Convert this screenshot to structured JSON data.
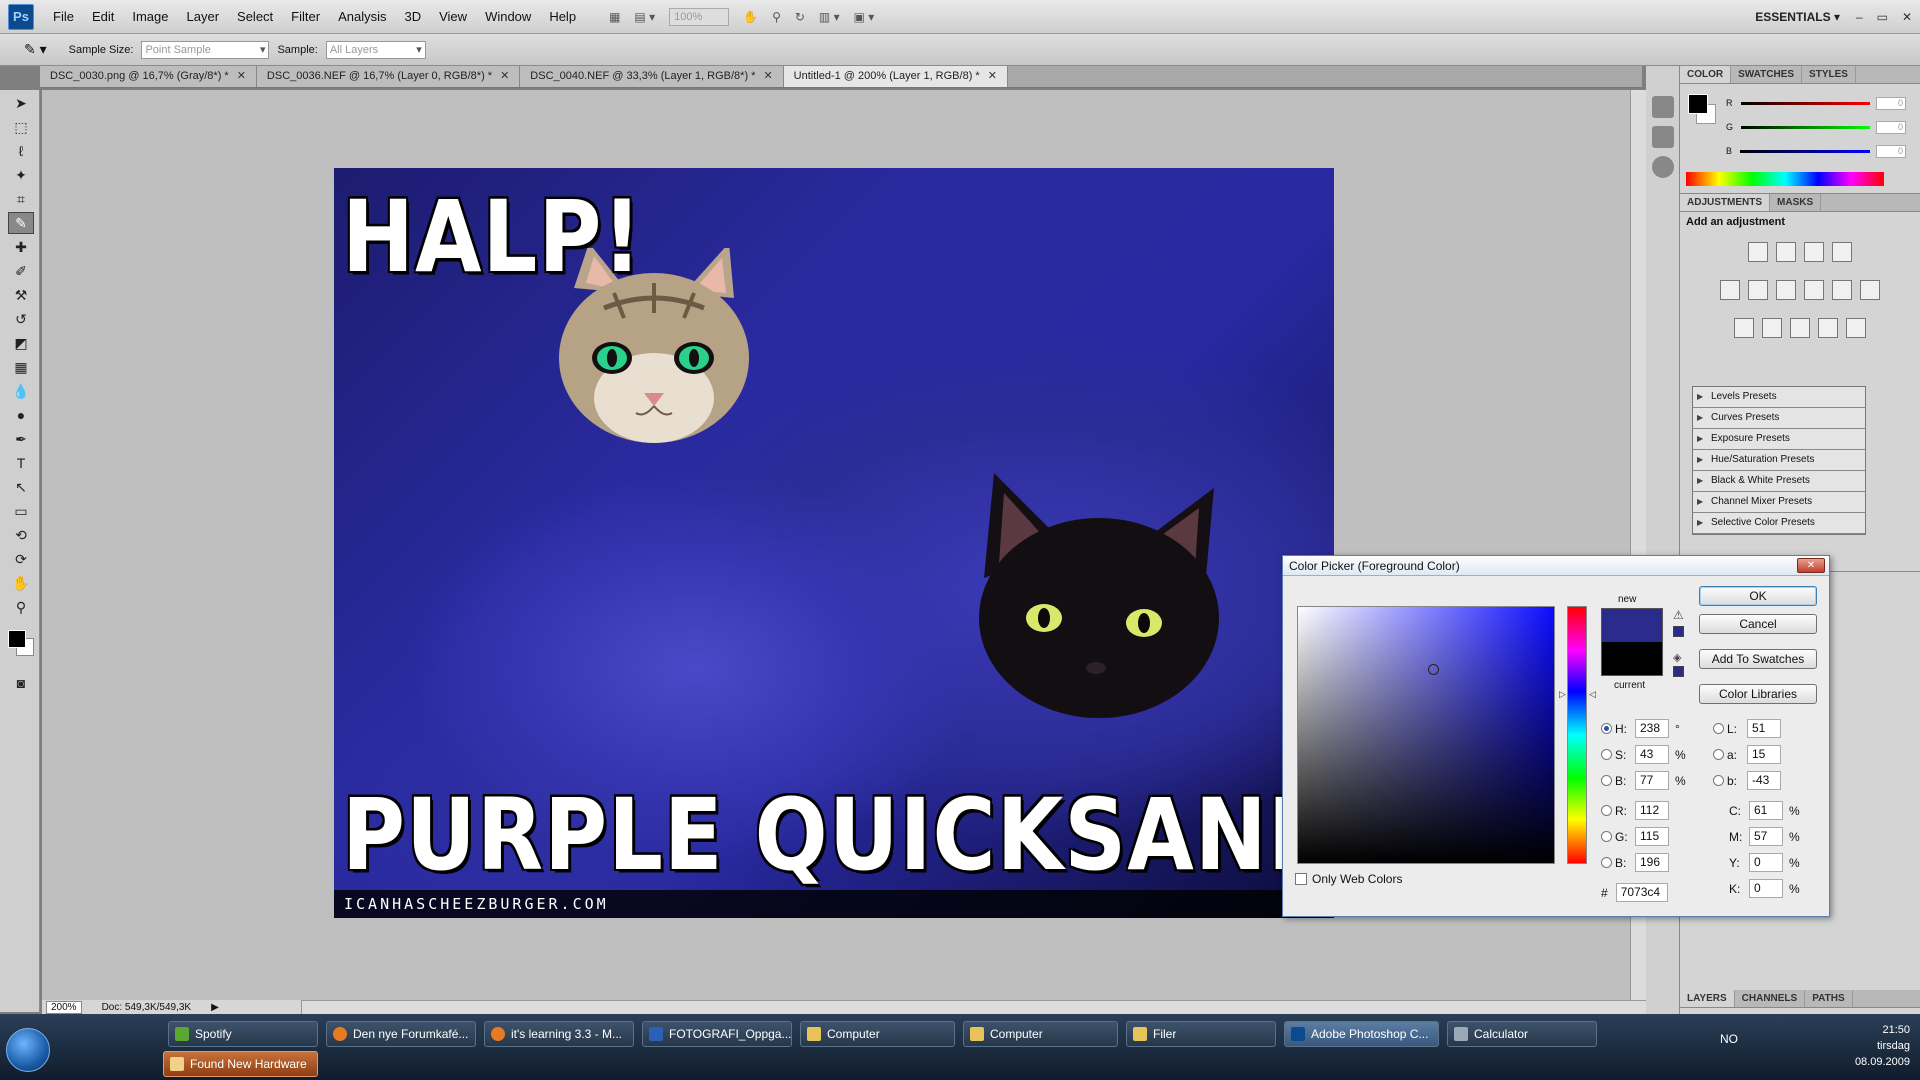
{
  "app": {
    "logo": "Ps",
    "menu": [
      "File",
      "Edit",
      "Image",
      "Layer",
      "Select",
      "Filter",
      "Analysis",
      "3D",
      "View",
      "Window",
      "Help"
    ],
    "zoom_field": "100%",
    "workspace": "ESSENTIALS",
    "window_controls": [
      "–",
      "▭",
      "✕"
    ]
  },
  "options": {
    "sample_size_label": "Sample Size:",
    "sample_size_value": "Point Sample",
    "sample_label": "Sample:",
    "sample_value": "All Layers"
  },
  "tabs": [
    {
      "label": "DSC_0030.png @ 16,7% (Gray/8*) *"
    },
    {
      "label": "DSC_0036.NEF @ 16,7% (Layer 0, RGB/8*) *"
    },
    {
      "label": "DSC_0040.NEF @ 33,3% (Layer 1, RGB/8*) *"
    },
    {
      "label": "Untitled-1 @ 200% (Layer 1, RGB/8) *"
    }
  ],
  "status": {
    "zoom": "200%",
    "doc": "Doc: 549,3K/549,3K"
  },
  "image": {
    "top_text": "HALP!",
    "bottom_text": "PURPLE QUICKSAND!",
    "watermark": "ICANHASCHEEZBURGER.COM"
  },
  "color_panel": {
    "tabs": [
      "COLOR",
      "SWATCHES",
      "STYLES"
    ],
    "r_label": "R",
    "g_label": "G",
    "b_label": "B",
    "r_value": "0",
    "g_value": "0",
    "b_value": "0"
  },
  "adjustments": {
    "tabs": [
      "ADJUSTMENTS",
      "MASKS"
    ],
    "heading": "Add an adjustment",
    "presets": [
      "Levels Presets",
      "Curves Presets",
      "Exposure Presets",
      "Hue/Saturation Presets",
      "Black & White Presets",
      "Channel Mixer Presets",
      "Selective Color Presets"
    ]
  },
  "layers": {
    "tabs": [
      "LAYERS",
      "CHANNELS",
      "PATHS"
    ]
  },
  "dialog": {
    "title": "Color Picker (Foreground Color)",
    "new_label": "new",
    "current_label": "current",
    "buttons": {
      "ok": "OK",
      "cancel": "Cancel",
      "add_swatches": "Add To Swatches",
      "color_libraries": "Color Libraries"
    },
    "hsb": {
      "h": "238",
      "s": "43",
      "b": "77",
      "h_unit": "°",
      "s_unit": "%",
      "b_unit": "%"
    },
    "rgb": {
      "r": "112",
      "g": "115",
      "b": "196"
    },
    "lab": {
      "l": "51",
      "a": "15",
      "b": "-43"
    },
    "cmyk": {
      "c": "61",
      "m": "57",
      "y": "0",
      "k": "0"
    },
    "labels": {
      "h": "H:",
      "s": "S:",
      "b": "B:",
      "r": "R:",
      "g": "G:",
      "bb": "B:",
      "l": "L:",
      "a": "a:",
      "lb": "b:",
      "c": "C:",
      "m": "M:",
      "y": "Y:",
      "k": "K:"
    },
    "only_web": "Only Web Colors",
    "hex_label": "#",
    "hex": "7073c4"
  },
  "taskbar": {
    "items": [
      "Spotify",
      "Den nye Forumkafé...",
      "it's learning 3.3 - M...",
      "FOTOGRAFI_Oppga...",
      "Computer",
      "Computer",
      "Filer",
      "Adobe Photoshop C...",
      "Calculator"
    ],
    "notice": "Found New Hardware",
    "lang": "NO",
    "time": "21:50",
    "day": "tirsdag",
    "date": "08.09.2009"
  },
  "colors": {
    "accent_blue": "#2b2b8c",
    "hw_orange": "#c8703a"
  }
}
